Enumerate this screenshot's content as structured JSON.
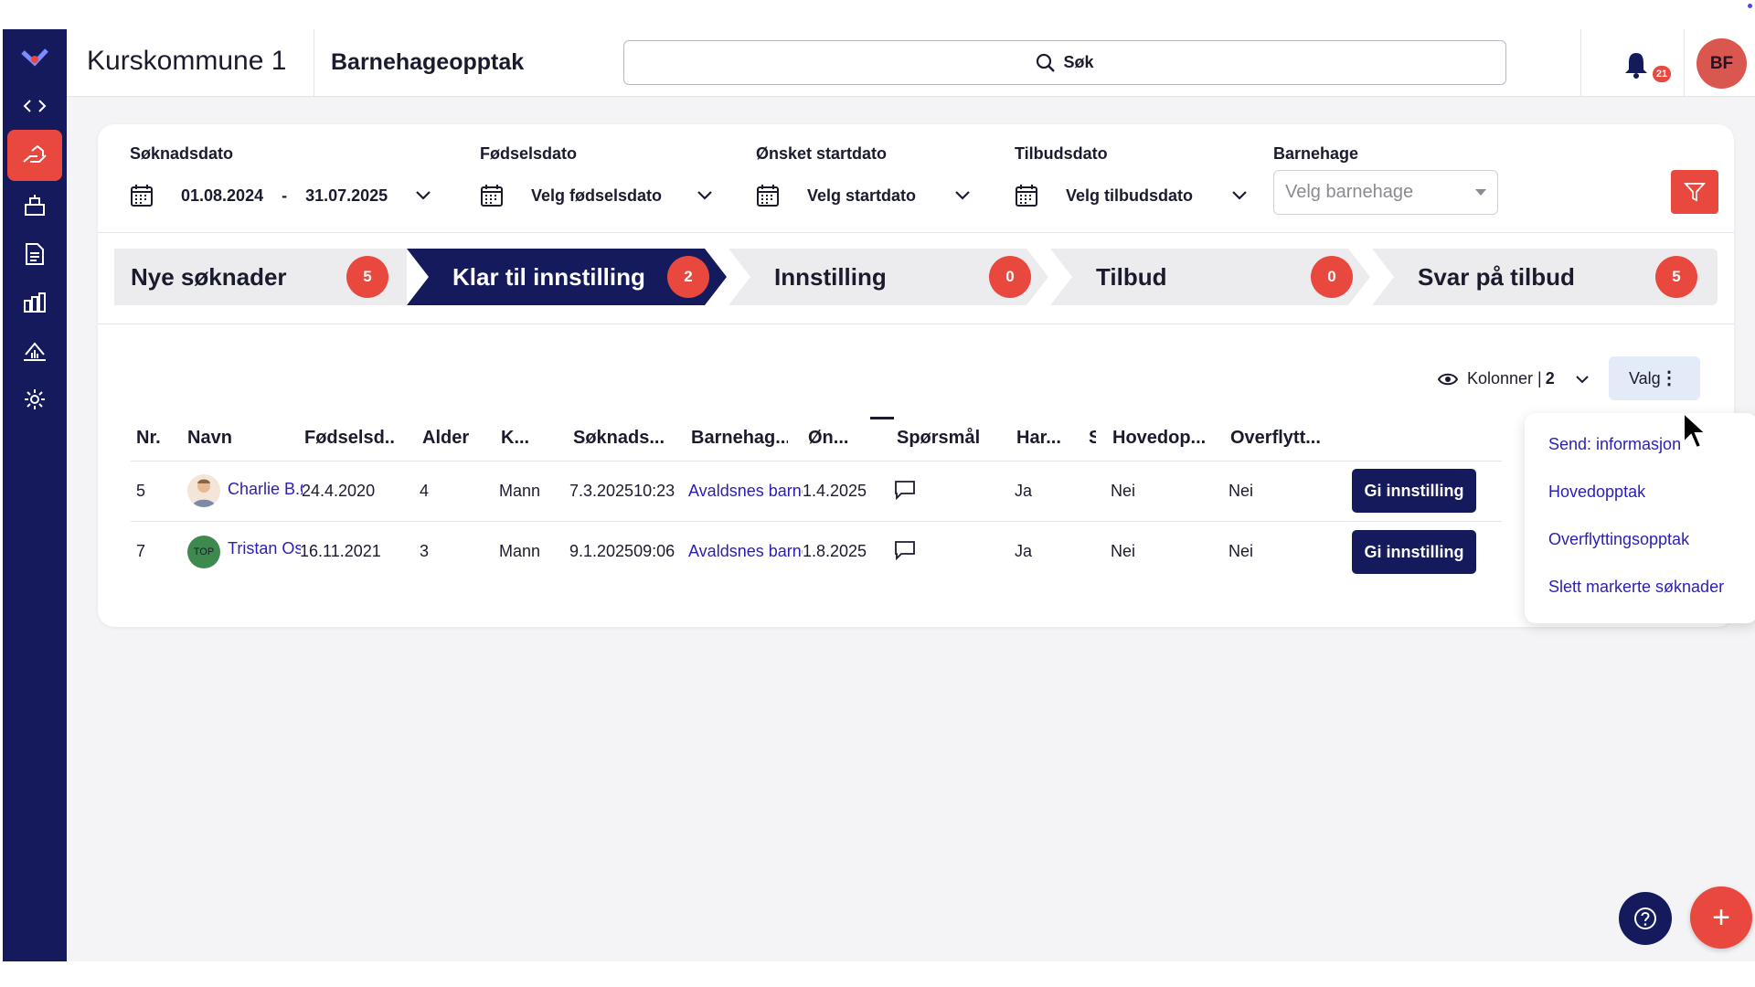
{
  "header": {
    "org_title": "Kurskommune 1",
    "module_title": "Barnehageopptak",
    "search_label": "Søk",
    "notification_count": "21",
    "avatar_initials": "BF"
  },
  "sidebar": {
    "items": [
      {
        "icon": "logo-icon"
      },
      {
        "icon": "code-brackets-icon"
      },
      {
        "icon": "hand-house-icon",
        "active": true
      },
      {
        "icon": "building-icon"
      },
      {
        "icon": "document-icon"
      },
      {
        "icon": "bar-chart-icon"
      },
      {
        "icon": "house-chart-icon"
      },
      {
        "icon": "gear-icon"
      }
    ]
  },
  "filters": {
    "soknadsdato": {
      "label": "Søknadsdato",
      "from": "01.08.2024",
      "separator": "-",
      "to": "31.07.2025"
    },
    "fodselsdato": {
      "label": "Fødselsdato",
      "value": "Velg fødselsdato"
    },
    "startdato": {
      "label": "Ønsket startdato",
      "value": "Velg startdato"
    },
    "tilbudsdato": {
      "label": "Tilbudsdato",
      "value": "Velg tilbudsdato"
    },
    "barnehage": {
      "label": "Barnehage",
      "placeholder": "Velg barnehage"
    }
  },
  "pipeline": [
    {
      "label": "Nye søknader",
      "count": "5"
    },
    {
      "label": "Klar til innstilling",
      "count": "2",
      "active": true
    },
    {
      "label": "Innstilling",
      "count": "0"
    },
    {
      "label": "Tilbud",
      "count": "0"
    },
    {
      "label": "Svar på tilbud",
      "count": "5"
    }
  ],
  "table_tools": {
    "columns_label": "Kolonner |",
    "columns_count": "2",
    "valg_label": "Valg",
    "valg_dots": "⋮"
  },
  "table": {
    "headers": [
      "Nr.",
      "Navn",
      "Fødselsd...",
      "Alder",
      "K...",
      "Søknads...",
      "Barnehag...",
      "Øn...",
      "Spørsmål",
      "Har...",
      "S",
      "Hovedop...",
      "Overflytt..."
    ],
    "rows": [
      {
        "nr": "5",
        "name": "Charlie B.Ø",
        "avatar": "photo",
        "fodselsdato": "24.4.2020",
        "alder": "4",
        "kjonn": "Mann",
        "soknadsdato": "7.3.202510:23",
        "barnehage": "Avaldsnes barne",
        "onsket": "1.4.2025",
        "har": "Ja",
        "hovedopptak": "Nei",
        "overflytting": "Nei",
        "action": "Gi innstilling"
      },
      {
        "nr": "7",
        "name": "Tristan Osv",
        "avatar": "TOP",
        "fodselsdato": "16.11.2021",
        "alder": "3",
        "kjonn": "Mann",
        "soknadsdato": "9.1.202509:06",
        "barnehage": "Avaldsnes barne",
        "onsket": "1.8.2025",
        "har": "Ja",
        "hovedopptak": "Nei",
        "overflytting": "Nei",
        "action": "Gi innstilling"
      }
    ]
  },
  "valg_menu": {
    "items": [
      "Send: informasjon",
      "Hovedopptak",
      "Overflyttingsopptak",
      "Slett markerte søknader"
    ]
  },
  "fab": {
    "add_label": "+"
  },
  "colors": {
    "navy": "#141a5c",
    "accent_red": "#e8483e",
    "link_blue": "#2a1fb4"
  }
}
